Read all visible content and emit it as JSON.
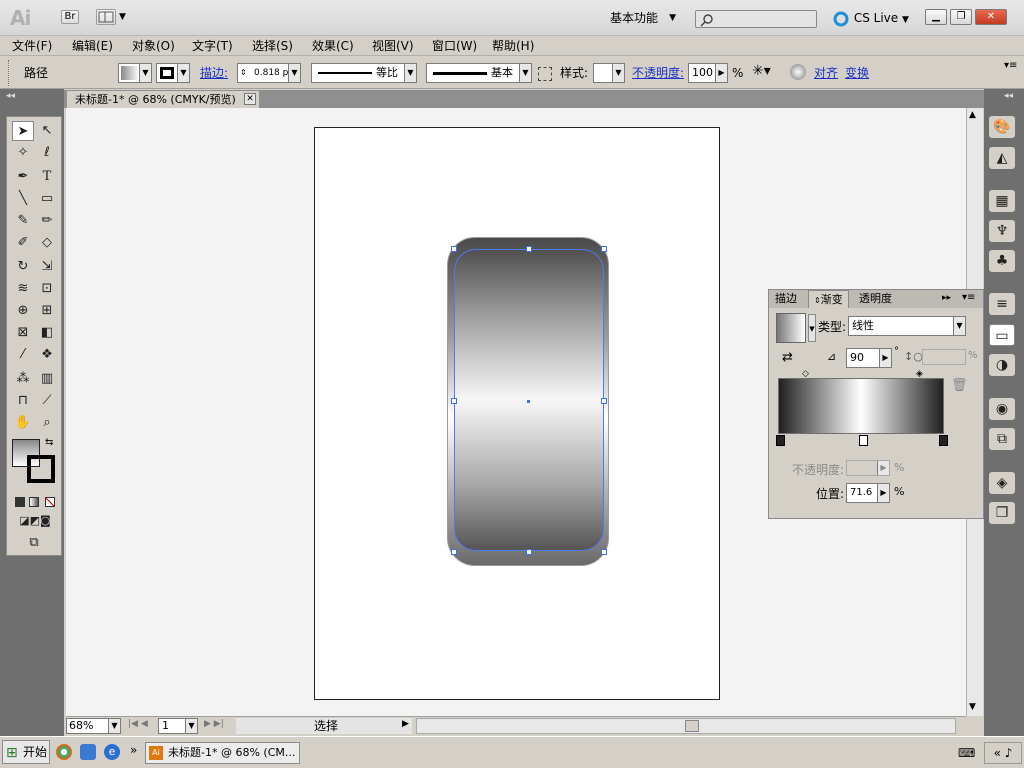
{
  "app": {
    "logo": "Ai",
    "bridge": "Br",
    "workspace": "基本功能",
    "cs_live": "CS Live"
  },
  "menu": [
    "文件(F)",
    "编辑(E)",
    "对象(O)",
    "文字(T)",
    "选择(S)",
    "效果(C)",
    "视图(V)",
    "窗口(W)",
    "帮助(H)"
  ],
  "control": {
    "selection_type": "路径",
    "stroke_label": "描边:",
    "stroke_weight": "0.818 p",
    "profile_ratio": "等比",
    "brush": "基本",
    "style_label": "样式:",
    "opacity_label": "不透明度:",
    "opacity_value": "100",
    "percent": "%",
    "align": "对齐",
    "transform": "变换"
  },
  "document": {
    "tab_title": "未标题-1* @ 68% (CMYK/预览)"
  },
  "status": {
    "zoom": "68%",
    "page": "1",
    "tool": "选择"
  },
  "gradient_panel": {
    "tabs": [
      "描边",
      "渐变",
      "透明度"
    ],
    "type_label": "类型:",
    "type_value": "线性",
    "angle": "90",
    "opacity_label": "不透明度:",
    "opacity_unit": "%",
    "position_label": "位置:",
    "position_value": "71.6",
    "position_unit": "%"
  },
  "taskbar": {
    "start": "开始",
    "task": "未标题-1* @ 68% (CM..."
  },
  "colors": {
    "selection": "#3f6ef0",
    "link": "#1a30c8",
    "cs_live_ring": "#1f8fd6"
  }
}
